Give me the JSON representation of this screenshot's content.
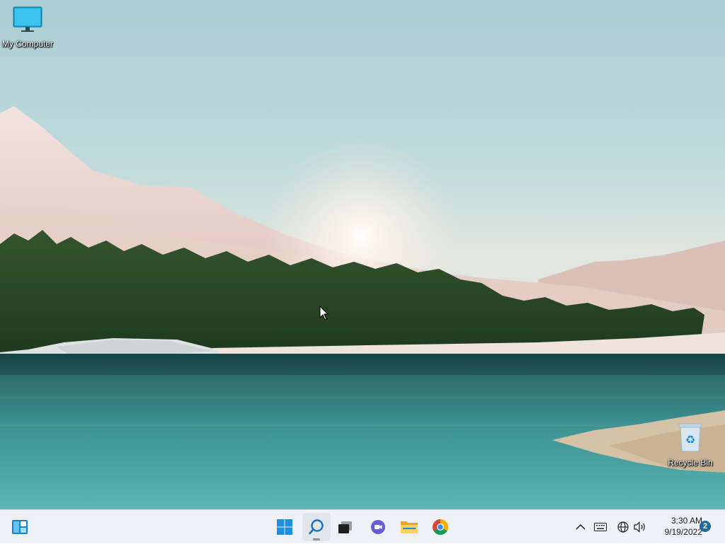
{
  "desktop": {
    "icons": [
      {
        "label": "My Computer",
        "icon": "monitor-icon"
      },
      {
        "label": "Recycle Bin",
        "icon": "recycle-bin-icon"
      }
    ]
  },
  "taskbar": {
    "buttons": [
      {
        "name": "widgets",
        "icon": "widgets-icon"
      },
      {
        "name": "start",
        "icon": "windows-logo-icon"
      },
      {
        "name": "search",
        "icon": "search-icon"
      },
      {
        "name": "task-view",
        "icon": "task-view-icon"
      },
      {
        "name": "chat",
        "icon": "teams-chat-icon"
      },
      {
        "name": "file-explorer",
        "icon": "folder-icon"
      },
      {
        "name": "chrome",
        "icon": "chrome-icon"
      }
    ],
    "tray": {
      "icons": [
        "chevron-up-icon",
        "keyboard-icon",
        "network-icon",
        "volume-icon"
      ],
      "time": "3:30 AM",
      "date": "9/19/2022",
      "notification_count": "2"
    }
  },
  "colors": {
    "taskbar_bg": "#eef1f5",
    "accent": "#0078d4",
    "badge": "#1f6c9c"
  }
}
